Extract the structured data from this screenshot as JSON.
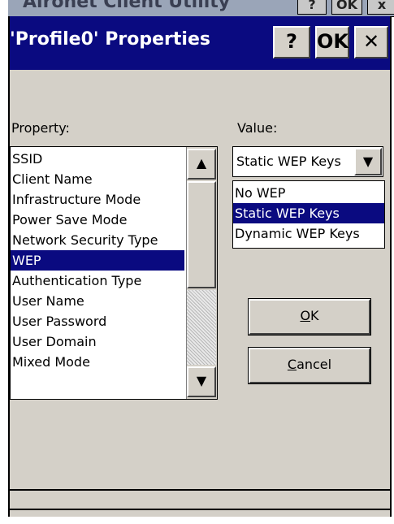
{
  "background_window": {
    "title": "Aironet Client Utility",
    "help_label": "?",
    "ok_label": "OK",
    "close_label": "x"
  },
  "dialog": {
    "title": "'Profile0' Properties",
    "help_label": "?",
    "ok_label": "OK",
    "close_label": "✕"
  },
  "property": {
    "label": "Property:",
    "items": [
      "SSID",
      "Client Name",
      "Infrastructure Mode",
      "Power Save Mode",
      "Network Security Type",
      "WEP",
      "Authentication Type",
      "User Name",
      "User Password",
      "User Domain",
      "Mixed Mode"
    ],
    "selected": "WEP"
  },
  "value": {
    "label": "Value:",
    "current": "Static WEP Keys",
    "options": [
      "No WEP",
      "Static WEP Keys",
      "Dynamic WEP Keys"
    ],
    "highlighted": "Static WEP Keys"
  },
  "buttons": {
    "ok_mnemonic": "O",
    "ok_rest": "K",
    "cancel_mnemonic": "C",
    "cancel_rest": "ancel"
  },
  "colors": {
    "titlebar": "#0a0a80",
    "selection": "#0a0a80",
    "face": "#d4d0c8"
  }
}
